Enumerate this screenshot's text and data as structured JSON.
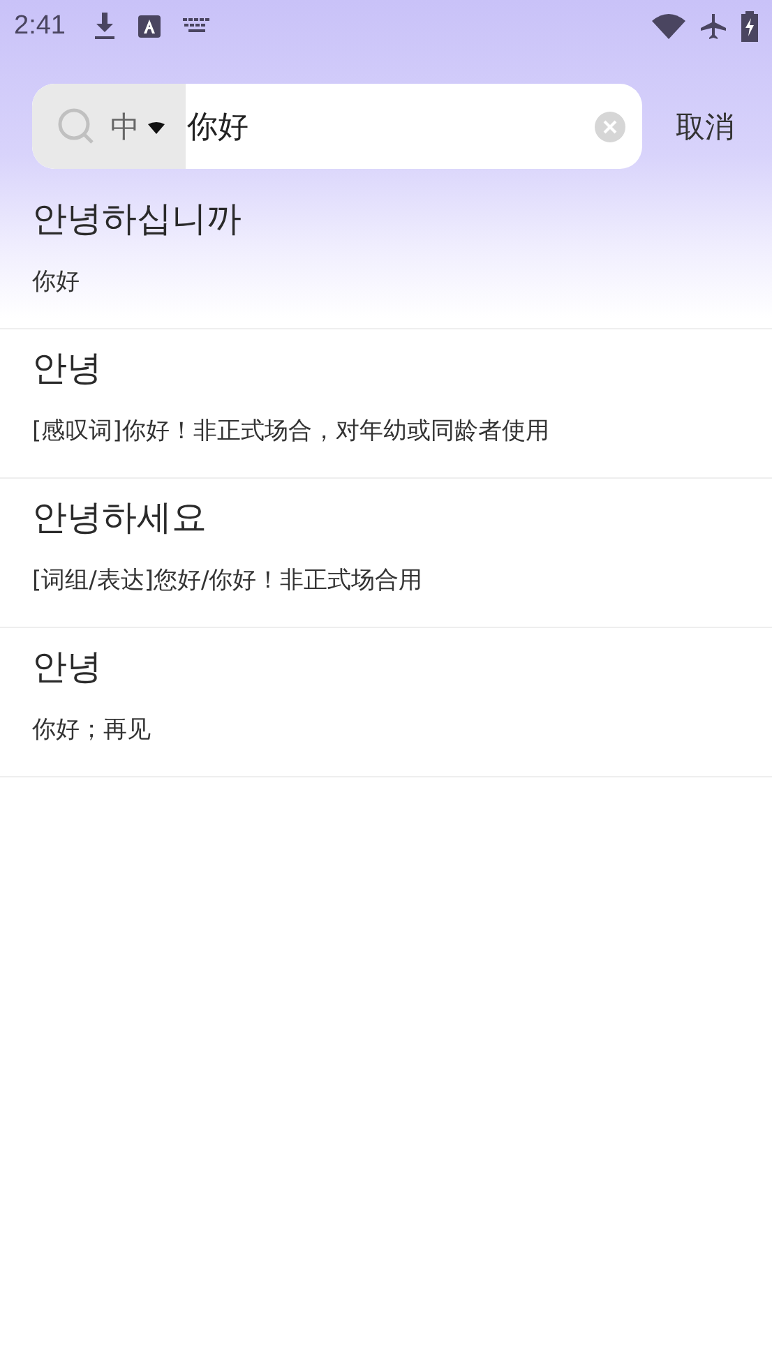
{
  "status_bar": {
    "time": "2:41"
  },
  "search": {
    "language": "中",
    "value": "你好",
    "cancel": "取消"
  },
  "results": [
    {
      "word": "안녕하십니까",
      "meaning": "你好"
    },
    {
      "word": "안녕",
      "meaning": "[感叹词]你好！非正式场合，对年幼或同龄者使用"
    },
    {
      "word": "안녕하세요",
      "meaning": "[词组/表达]您好/你好！非正式场合用"
    },
    {
      "word": "안녕",
      "meaning": "你好；再见"
    }
  ]
}
